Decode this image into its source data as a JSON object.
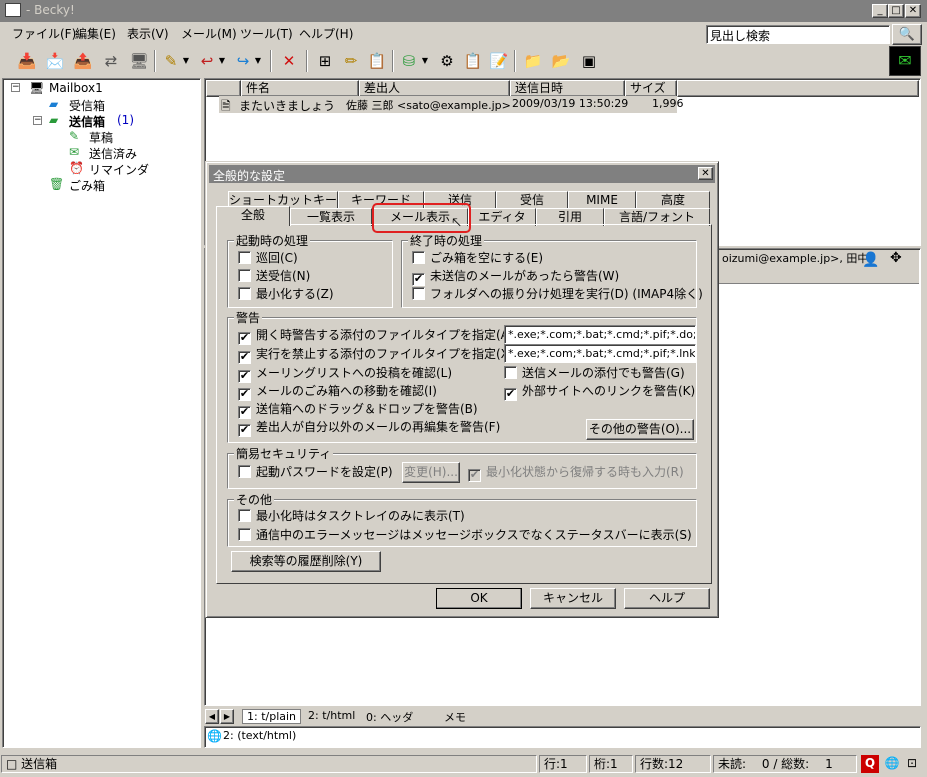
{
  "window": {
    "title": "- Becky!"
  },
  "menu": [
    "ファイル(F)",
    "編集(E)",
    "表示(V)",
    "メール(M)",
    "ツール(T)",
    "ヘルプ(H)"
  ],
  "header_search": {
    "value": "見出し検索"
  },
  "folders": {
    "root": "Mailbox1",
    "inbox": "受信箱",
    "outbox": "送信箱",
    "outbox_count": "(1)",
    "drafts": "草稿",
    "sent": "送信済み",
    "reminders": "リマインダ",
    "trash": "ごみ箱"
  },
  "list": {
    "columns": [
      "件名",
      "差出人",
      "送信日時",
      "サイズ"
    ],
    "rows": [
      {
        "subject": "またいきましょう",
        "from": "佐藤 三郎 <sato@example.jp>",
        "date": "2009/03/19 13:50:29",
        "size": "1,996"
      }
    ]
  },
  "preview": {
    "to_text": "oizumi@example.jp>, 田中"
  },
  "bottom_tabs": [
    "1: t/plain",
    "2: t/html",
    "0: ヘッダ",
    "メモ"
  ],
  "attachment": "2: (text/html)",
  "status": {
    "folder": "送信箱",
    "line": "行:1",
    "col": "桁:1",
    "lines": "行数:12",
    "unread": "未読:",
    "unread_total": "0 / 総数:",
    "total": "1"
  },
  "dialog": {
    "title": "全般的な設定",
    "tabs_back": [
      "ショートカットキー",
      "キーワード",
      "送信",
      "受信",
      "MIME",
      "高度"
    ],
    "tabs_front": [
      "全般",
      "一覧表示",
      "メール表示",
      "エディタ",
      "引用",
      "言語/フォント"
    ],
    "startup": {
      "legend": "起動時の処理",
      "items": [
        {
          "label": "巡回(C)",
          "checked": false
        },
        {
          "label": "送受信(N)",
          "checked": false
        },
        {
          "label": "最小化する(Z)",
          "checked": false
        }
      ]
    },
    "shutdown": {
      "legend": "終了時の処理",
      "items": [
        {
          "label": "ごみ箱を空にする(E)",
          "checked": false
        },
        {
          "label": "未送信のメールがあったら警告(W)",
          "checked": true
        },
        {
          "label": "フォルダへの振り分け処理を実行(D) (IMAP4除く)",
          "checked": false
        }
      ]
    },
    "warnings": {
      "legend": "警告",
      "open_attach": {
        "label": "開く時警告する添付のファイルタイプを指定(A):",
        "checked": true,
        "value": "*.exe;*.com;*.bat;*.cmd;*.pif;*.do;*.xl;*"
      },
      "block_attach": {
        "label": "実行を禁止する添付のファイルタイプを指定(X):",
        "checked": true,
        "value": "*.exe;*.com;*.bat;*.cmd;*.pif;*.lnk;*.scr"
      },
      "mailing_list": {
        "label": "メーリングリストへの投稿を確認(L)",
        "checked": true
      },
      "sent_attach": {
        "label": "送信メールの添付でも警告(G)",
        "checked": false
      },
      "move_trash": {
        "label": "メールのごみ箱への移動を確認(I)",
        "checked": true
      },
      "external_link": {
        "label": "外部サイトへのリンクを警告(K)",
        "checked": true
      },
      "drag_outbox": {
        "label": "送信箱へのドラッグ＆ドロップを警告(B)",
        "checked": true
      },
      "reedit": {
        "label": "差出人が自分以外のメールの再編集を警告(F)",
        "checked": true
      },
      "other_button": "その他の警告(O)..."
    },
    "security": {
      "legend": "簡易セキュリティ",
      "password": {
        "label": "起動パスワードを設定(P)",
        "checked": false
      },
      "change_button": "変更(H)...",
      "minimized": {
        "label": "最小化状態から復帰する時も入力(R)",
        "checked": true
      }
    },
    "other": {
      "legend": "その他",
      "items": [
        {
          "label": "最小化時はタスクトレイのみに表示(T)",
          "checked": false
        },
        {
          "label": "通信中のエラーメッセージはメッセージボックスでなくステータスバーに表示(S)",
          "checked": false
        }
      ]
    },
    "clear_history_button": "検索等の履歴削除(Y)",
    "buttons": {
      "ok": "OK",
      "cancel": "キャンセル",
      "help": "ヘルプ"
    }
  }
}
